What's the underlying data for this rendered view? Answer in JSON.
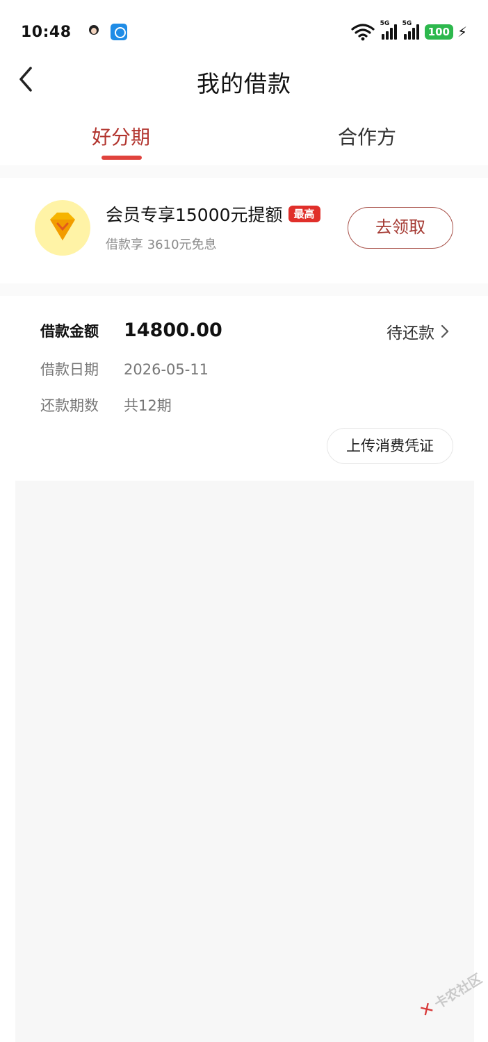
{
  "status_bar": {
    "time": "10:48",
    "network_1": "5G",
    "network_2": "5G",
    "battery": "100",
    "battery_color": "#2db84d",
    "icons": [
      "avatar-notification-icon",
      "app-notification-icon",
      "wifi-icon",
      "signal-icon",
      "signal-icon",
      "battery-icon",
      "charging-icon"
    ]
  },
  "nav": {
    "title": "我的借款",
    "back_icon": "chevron-left-icon"
  },
  "tabs": [
    {
      "label": "好分期",
      "active": true
    },
    {
      "label": "合作方",
      "active": false
    }
  ],
  "accent_color": "#e0433d",
  "promo": {
    "icon": "diamond-icon",
    "title": "会员专享15000元提额",
    "badge": "最高",
    "subtitle": "借款享 3610元免息",
    "button_label": "去领取"
  },
  "loan": {
    "amount_label": "借款金额",
    "amount_value": "14800.00",
    "status_text": "待还款",
    "date_label": "借款日期",
    "date_value": "2026-05-11",
    "terms_label": "还款期数",
    "terms_value": "共12期",
    "upload_label": "上传消费凭证"
  },
  "watermark": {
    "text": "卡农社区"
  }
}
